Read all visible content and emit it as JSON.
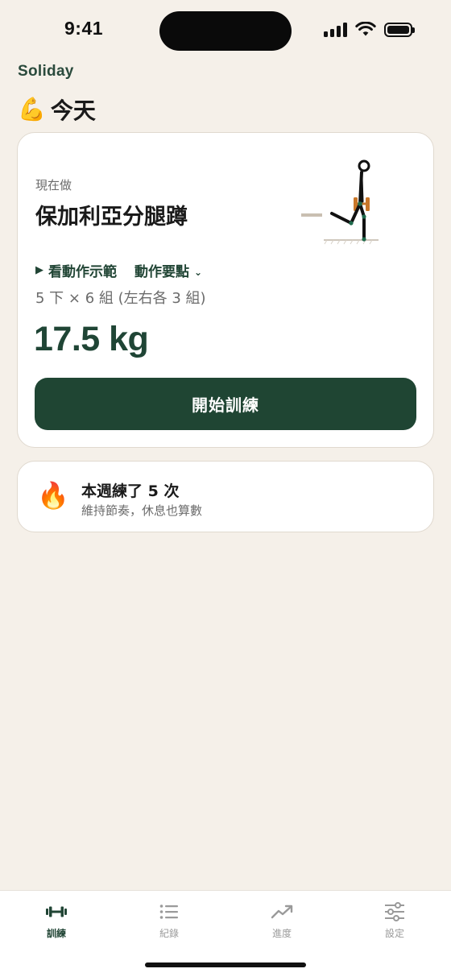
{
  "status_bar": {
    "time": "9:41"
  },
  "header": {
    "brand": "Soliday",
    "title_icon": "💪",
    "title": "今天"
  },
  "today_card": {
    "label": "現在做",
    "exercise": "保加利亞分腿蹲",
    "demo_link": "看動作示範",
    "tips_link": "動作要點",
    "sets": "5 下 × 6 組 (左右各 3 組)",
    "weight": "17.5 kg",
    "start_button": "開始訓練"
  },
  "streak_card": {
    "icon": "🔥",
    "title": "本週練了 5 次",
    "subtitle": "維持節奏，休息也算數"
  },
  "tab_bar": {
    "tabs": [
      {
        "label": "訓練",
        "icon": "dumbbell-icon",
        "active": true
      },
      {
        "label": "紀錄",
        "icon": "list-icon",
        "active": false
      },
      {
        "label": "進度",
        "icon": "trend-up-icon",
        "active": false
      },
      {
        "label": "設定",
        "icon": "sliders-icon",
        "active": false
      }
    ]
  },
  "colors": {
    "accent": "#1f4533",
    "background": "#f5f0e9",
    "card": "#ffffff",
    "muted": "#6b6b6b",
    "dumbbell_weight": "#c8772a"
  }
}
